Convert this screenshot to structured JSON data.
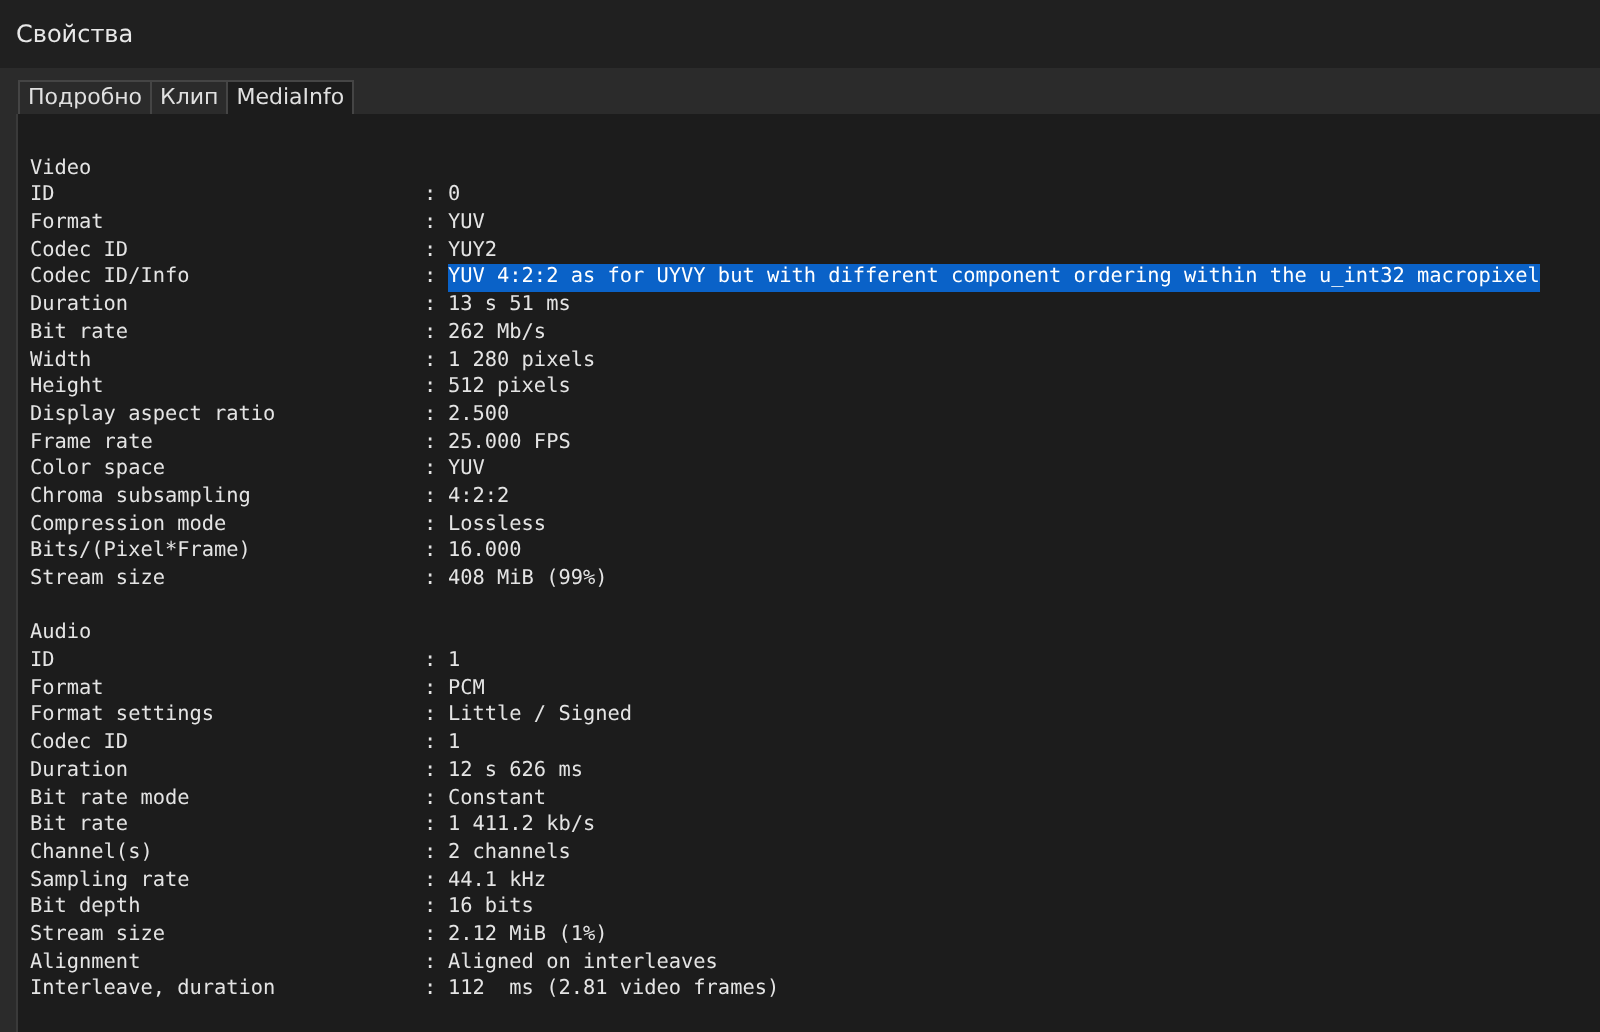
{
  "window": {
    "title": "Свойства"
  },
  "tabs": [
    {
      "label": "Подробно",
      "selected": false
    },
    {
      "label": "Клип",
      "selected": false
    },
    {
      "label": "MediaInfo",
      "selected": true
    }
  ],
  "sections": [
    {
      "title": "Video",
      "rows": [
        {
          "label": "ID",
          "sep": ":",
          "value": "0",
          "selected": false
        },
        {
          "label": "Format",
          "sep": ":",
          "value": "YUV",
          "selected": false
        },
        {
          "label": "Codec ID",
          "sep": ":",
          "value": "YUY2",
          "selected": false
        },
        {
          "label": "Codec ID/Info",
          "sep": ":",
          "value": "YUV 4:2:2 as for UYVY but with different component ordering within the u_int32 macropixel",
          "selected": true
        },
        {
          "label": "Duration",
          "sep": ":",
          "value": "13 s 51 ms",
          "selected": false
        },
        {
          "label": "Bit rate",
          "sep": ":",
          "value": "262 Mb/s",
          "selected": false
        },
        {
          "label": "Width",
          "sep": ":",
          "value": "1 280 pixels",
          "selected": false
        },
        {
          "label": "Height",
          "sep": ":",
          "value": "512 pixels",
          "selected": false
        },
        {
          "label": "Display aspect ratio",
          "sep": ":",
          "value": "2.500",
          "selected": false
        },
        {
          "label": "Frame rate",
          "sep": ":",
          "value": "25.000 FPS",
          "selected": false
        },
        {
          "label": "Color space",
          "sep": ":",
          "value": "YUV",
          "selected": false
        },
        {
          "label": "Chroma subsampling",
          "sep": ":",
          "value": "4:2:2",
          "selected": false
        },
        {
          "label": "Compression mode",
          "sep": ":",
          "value": "Lossless",
          "selected": false
        },
        {
          "label": "Bits/(Pixel*Frame)",
          "sep": ":",
          "value": "16.000",
          "selected": false
        },
        {
          "label": "Stream size",
          "sep": ":",
          "value": "408 MiB (99%)",
          "selected": false
        }
      ]
    },
    {
      "title": "Audio",
      "rows": [
        {
          "label": "ID",
          "sep": ":",
          "value": "1",
          "selected": false
        },
        {
          "label": "Format",
          "sep": ":",
          "value": "PCM",
          "selected": false
        },
        {
          "label": "Format settings",
          "sep": ":",
          "value": "Little / Signed",
          "selected": false
        },
        {
          "label": "Codec ID",
          "sep": ":",
          "value": "1",
          "selected": false
        },
        {
          "label": "Duration",
          "sep": ":",
          "value": "12 s 626 ms",
          "selected": false
        },
        {
          "label": "Bit rate mode",
          "sep": ":",
          "value": "Constant",
          "selected": false
        },
        {
          "label": "Bit rate",
          "sep": ":",
          "value": "1 411.2 kb/s",
          "selected": false
        },
        {
          "label": "Channel(s)",
          "sep": ":",
          "value": "2 channels",
          "selected": false
        },
        {
          "label": "Sampling rate",
          "sep": ":",
          "value": "44.1 kHz",
          "selected": false
        },
        {
          "label": "Bit depth",
          "sep": ":",
          "value": "16 bits",
          "selected": false
        },
        {
          "label": "Stream size",
          "sep": ":",
          "value": "2.12 MiB (1%)",
          "selected": false
        },
        {
          "label": "Alignment",
          "sep": ":",
          "value": "Aligned on interleaves",
          "selected": false
        },
        {
          "label": "Interleave, duration",
          "sep": ":",
          "value": "112  ms (2.81 video frames)",
          "selected": false
        }
      ]
    }
  ]
}
